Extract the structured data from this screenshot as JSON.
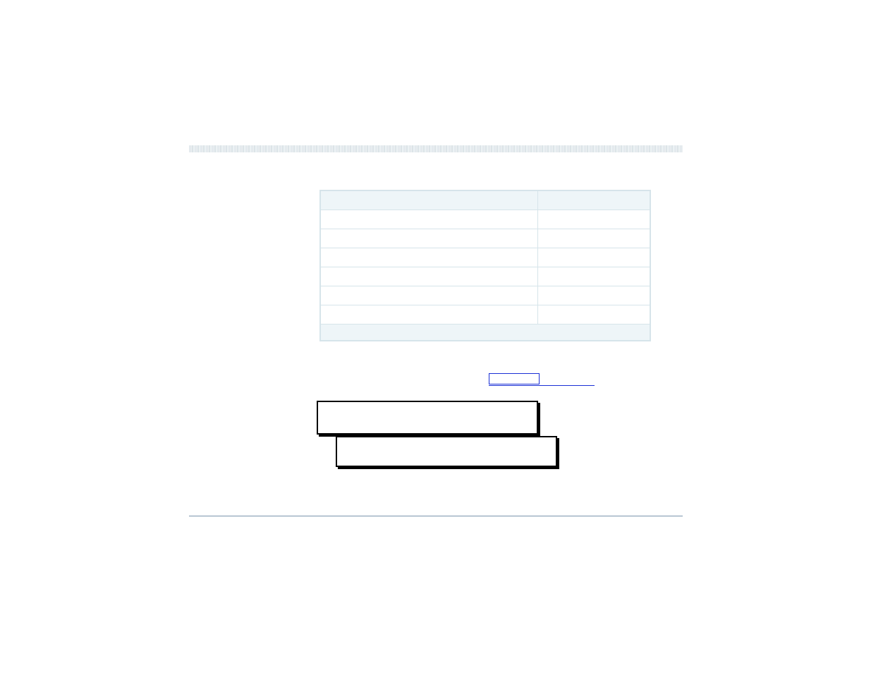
{
  "banner": {
    "text": ""
  },
  "table": {
    "header": {
      "col1": "",
      "col2": ""
    },
    "rows": [
      {
        "col1": "",
        "col2": ""
      },
      {
        "col1": "",
        "col2": ""
      },
      {
        "col1": "",
        "col2": ""
      },
      {
        "col1": "",
        "col2": ""
      },
      {
        "col1": "",
        "col2": ""
      },
      {
        "col1": "",
        "col2": ""
      }
    ],
    "footer": ""
  },
  "link": {
    "label": ""
  },
  "boxes": [
    {
      "text": ""
    },
    {
      "text": ""
    }
  ]
}
